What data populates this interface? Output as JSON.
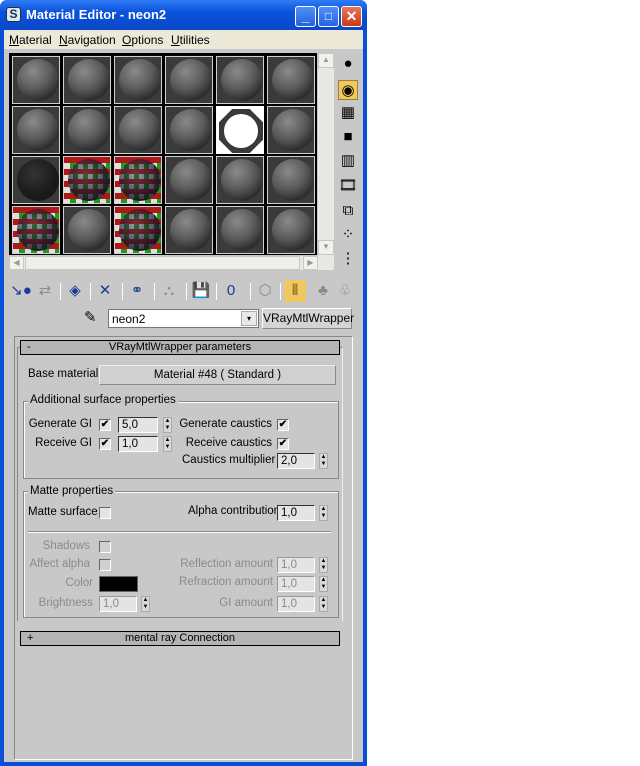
{
  "window": {
    "title": "Material Editor - neon2",
    "minimize": "_",
    "maximize": "□",
    "close": "✕"
  },
  "menu": [
    {
      "label": "Material",
      "key": "M",
      "rest": "aterial"
    },
    {
      "label": "Navigation",
      "key": "N",
      "rest": "avigation"
    },
    {
      "label": "Options",
      "key": "O",
      "rest": "ptions"
    },
    {
      "label": "Utilities",
      "key": "U",
      "rest": "tilities"
    }
  ],
  "slots": [
    "std",
    "std",
    "std",
    "std",
    "std",
    "std",
    "std",
    "std",
    "std",
    "std",
    "selected",
    "std",
    "dark",
    "checker",
    "checker",
    "std",
    "std",
    "std",
    "checker",
    "std",
    "checker",
    "std",
    "std",
    "std"
  ],
  "side_tools": [
    {
      "name": "sample-type-icon",
      "glyph": "●"
    },
    {
      "name": "backlight-icon",
      "glyph": "◉"
    },
    {
      "name": "background-checker-icon",
      "glyph": "▦"
    },
    {
      "name": "sample-uv-tiling-icon",
      "glyph": "■"
    },
    {
      "name": "video-color-check-icon",
      "glyph": "▥"
    },
    {
      "name": "make-preview-icon",
      "glyph": "🎞"
    },
    {
      "name": "options-icon",
      "glyph": "⧉"
    },
    {
      "name": "select-by-material-icon",
      "glyph": "⁘"
    },
    {
      "name": "material-navigator-icon",
      "glyph": "⋮"
    }
  ],
  "toolbar": [
    {
      "name": "get-material-icon",
      "glyph": "↘●"
    },
    {
      "name": "put-to-scene-icon",
      "glyph": "⇄"
    },
    {
      "name": "assign-to-selection-icon",
      "glyph": "◈"
    },
    {
      "name": "reset-map-icon",
      "glyph": "✕"
    },
    {
      "name": "make-copy-icon",
      "glyph": "⚭"
    },
    {
      "name": "make-unique-icon",
      "glyph": "⛬"
    },
    {
      "name": "put-to-library-icon",
      "glyph": "💾"
    },
    {
      "name": "material-effects-channel-icon",
      "glyph": "0"
    },
    {
      "name": "show-map-in-viewport-icon",
      "glyph": "⬡"
    },
    {
      "name": "show-end-result-icon",
      "glyph": "⫴"
    },
    {
      "name": "go-to-parent-icon",
      "glyph": "♣"
    },
    {
      "name": "go-forward-to-sibling-icon",
      "glyph": "♧"
    }
  ],
  "name_row": {
    "material_name": "neon2",
    "type_button": "VRayMtlWrapper",
    "dropdown": "▾",
    "picker": "✎"
  },
  "rollout": {
    "minus": "-",
    "title": "VRayMtlWrapper parameters",
    "base_label": "Base material:",
    "base_value": "Material #48  ( Standard )"
  },
  "surface": {
    "title": "Additional surface properties",
    "generate_gi": "Generate GI",
    "generate_gi_checked": true,
    "generate_gi_value": "5,0",
    "receive_gi": "Receive GI",
    "receive_gi_checked": true,
    "receive_gi_value": "1,0",
    "generate_caustics": "Generate caustics",
    "generate_caustics_checked": true,
    "receive_caustics": "Receive caustics",
    "receive_caustics_checked": true,
    "caustics_multiplier": "Caustics multiplier",
    "caustics_multiplier_value": "2,0"
  },
  "matte": {
    "title": "Matte properties",
    "matte_surface": "Matte surface",
    "alpha_contribution": "Alpha contribution",
    "alpha_value": "1,0",
    "shadows": "Shadows",
    "affect_alpha": "Affect alpha",
    "color": "Color",
    "color_value": "#000000",
    "brightness": "Brightness",
    "brightness_value": "1,0",
    "reflection": "Reflection amount",
    "reflection_value": "1,0",
    "refraction": "Refraction amount",
    "refraction_value": "1,0",
    "gi_amount": "GI amount",
    "gi_amount_value": "1,0"
  },
  "mental_ray": {
    "plus": "+",
    "title": "mental ray Connection"
  },
  "check_glyph": "✔",
  "spin_glyph": "▲▼"
}
